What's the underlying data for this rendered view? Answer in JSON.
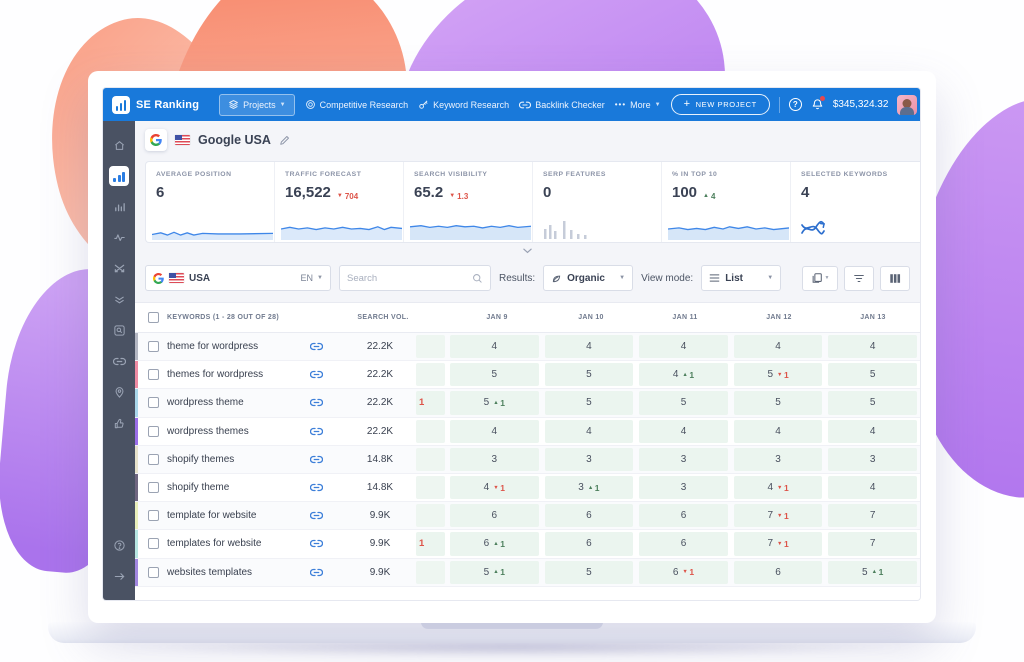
{
  "nav": {
    "brand": "SE Ranking",
    "items": [
      {
        "label": "Projects",
        "icon": "layers-icon"
      },
      {
        "label": "Competitive Research",
        "icon": "target-icon"
      },
      {
        "label": "Keyword Research",
        "icon": "key-icon"
      },
      {
        "label": "Backlink Checker",
        "icon": "link-icon"
      },
      {
        "label": "More",
        "icon": "dots-icon"
      }
    ],
    "new_project_label": "NEW PROJECT",
    "balance": "$345,324.32"
  },
  "sidebar": {
    "icons": [
      "home",
      "rankings",
      "analytics",
      "monitoring",
      "competitors",
      "flow",
      "audit",
      "backlinks",
      "locations",
      "social",
      "help",
      "collapse"
    ]
  },
  "project": {
    "title": "Google USA"
  },
  "stats": {
    "cells": [
      {
        "label": "AVERAGE POSITION",
        "value": "6"
      },
      {
        "label": "TRAFFIC FORECAST",
        "value": "16,522",
        "delta": "704",
        "dir": "down"
      },
      {
        "label": "SEARCH VISIBILITY",
        "value": "65.2",
        "delta": "1.3",
        "dir": "down"
      },
      {
        "label": "SERP FEATURES",
        "value": "0"
      },
      {
        "label": "% IN TOP 10",
        "value": "100",
        "delta": "4",
        "dir": "up"
      },
      {
        "label": "SELECTED KEYWORDS",
        "value": "4"
      }
    ]
  },
  "toolbar": {
    "country": "USA",
    "language": "EN",
    "search_placeholder": "Search",
    "results_label": "Results:",
    "results_value": "Organic",
    "viewmode_label": "View mode:",
    "viewmode_value": "List"
  },
  "table": {
    "header": {
      "keywords": "KEYWORDS (1 - 28 OUT OF 28)",
      "search_vol": "SEARCH VOL.",
      "dates": [
        "JAN 9",
        "JAN 10",
        "JAN 11",
        "JAN 12",
        "JAN 13"
      ]
    },
    "rows": [
      {
        "keyword": "theme for wordpress",
        "volume": "22.2K",
        "marker": "#b4b7c3",
        "trunc": "",
        "cells": [
          {
            "v": "4"
          },
          {
            "v": "4"
          },
          {
            "v": "4"
          },
          {
            "v": "4"
          },
          {
            "v": "4"
          }
        ]
      },
      {
        "keyword": "themes for wordpress",
        "volume": "22.2K",
        "marker": "#ee8ba3",
        "trunc": "",
        "cells": [
          {
            "v": "5"
          },
          {
            "v": "5"
          },
          {
            "v": "4",
            "d": "1",
            "dir": "up"
          },
          {
            "v": "5",
            "d": "1",
            "dir": "down"
          },
          {
            "v": "5"
          }
        ]
      },
      {
        "keyword": "wordpress theme",
        "volume": "22.2K",
        "marker": "#a9d7ea",
        "trunc": "1",
        "cells": [
          {
            "v": "5",
            "d": "1",
            "dir": "up"
          },
          {
            "v": "5"
          },
          {
            "v": "5"
          },
          {
            "v": "5"
          },
          {
            "v": "5"
          }
        ]
      },
      {
        "keyword": "wordpress themes",
        "volume": "22.2K",
        "marker": "#9b6ee8",
        "trunc": "",
        "cells": [
          {
            "v": "4"
          },
          {
            "v": "4"
          },
          {
            "v": "4"
          },
          {
            "v": "4"
          },
          {
            "v": "4"
          }
        ]
      },
      {
        "keyword": "shopify themes",
        "volume": "14.8K",
        "marker": "#e7e2cb",
        "trunc": "",
        "cells": [
          {
            "v": "3"
          },
          {
            "v": "3"
          },
          {
            "v": "3"
          },
          {
            "v": "3"
          },
          {
            "v": "3"
          }
        ]
      },
      {
        "keyword": "shopify theme",
        "volume": "14.8K",
        "marker": "#6f6680",
        "trunc": "",
        "cells": [
          {
            "v": "4",
            "d": "1",
            "dir": "down"
          },
          {
            "v": "3",
            "d": "1",
            "dir": "up"
          },
          {
            "v": "3"
          },
          {
            "v": "4",
            "d": "1",
            "dir": "down"
          },
          {
            "v": "4"
          }
        ]
      },
      {
        "keyword": "template for website",
        "volume": "9.9K",
        "marker": "#e9efbb",
        "trunc": "",
        "cells": [
          {
            "v": "6"
          },
          {
            "v": "6"
          },
          {
            "v": "6"
          },
          {
            "v": "7",
            "d": "1",
            "dir": "down"
          },
          {
            "v": "7"
          }
        ]
      },
      {
        "keyword": "templates for website",
        "volume": "9.9K",
        "marker": "#b7e6e2",
        "trunc": "1",
        "cells": [
          {
            "v": "6",
            "d": "1",
            "dir": "up"
          },
          {
            "v": "6"
          },
          {
            "v": "6"
          },
          {
            "v": "7",
            "d": "1",
            "dir": "down"
          },
          {
            "v": "7"
          }
        ]
      },
      {
        "keyword": "websites templates",
        "volume": "9.9K",
        "marker": "#a287e0",
        "trunc": "",
        "cells": [
          {
            "v": "5",
            "d": "1",
            "dir": "up"
          },
          {
            "v": "5"
          },
          {
            "v": "6",
            "d": "1",
            "dir": "down"
          },
          {
            "v": "6"
          },
          {
            "v": "5",
            "d": "1",
            "dir": "up"
          }
        ]
      }
    ]
  },
  "colors": {
    "accent": "#1979da",
    "up": "#4c7f5c",
    "down": "#dd5449",
    "cell_bg": "#ebf5ef"
  }
}
